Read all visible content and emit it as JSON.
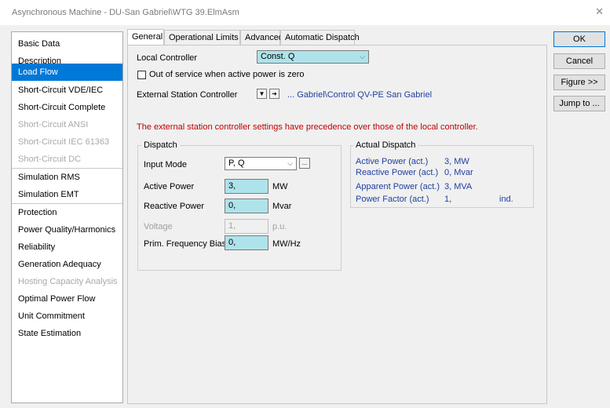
{
  "window": {
    "title": "Asynchronous Machine - DU-San Gabriel\\WTG 39.ElmAsm",
    "close_glyph": "✕"
  },
  "nav": {
    "items": [
      {
        "label": "Basic Data",
        "state": "normal"
      },
      {
        "label": "Description",
        "state": "normal"
      },
      {
        "label": "Load Flow",
        "state": "selected"
      },
      {
        "label": "Short-Circuit VDE/IEC",
        "state": "normal"
      },
      {
        "label": "Short-Circuit Complete",
        "state": "normal"
      },
      {
        "label": "Short-Circuit ANSI",
        "state": "disabled"
      },
      {
        "label": "Short-Circuit IEC 61363",
        "state": "disabled"
      },
      {
        "label": "Short-Circuit DC",
        "state": "disabled"
      },
      {
        "label": "Simulation RMS",
        "state": "normal"
      },
      {
        "label": "Simulation EMT",
        "state": "normal"
      },
      {
        "label": "Protection",
        "state": "normal"
      },
      {
        "label": "Power Quality/Harmonics",
        "state": "normal"
      },
      {
        "label": "Reliability",
        "state": "normal"
      },
      {
        "label": "Generation Adequacy",
        "state": "normal"
      },
      {
        "label": "Hosting Capacity Analysis",
        "state": "disabled"
      },
      {
        "label": "Optimal Power Flow",
        "state": "normal"
      },
      {
        "label": "Unit Commitment",
        "state": "normal"
      },
      {
        "label": "State Estimation",
        "state": "normal"
      }
    ]
  },
  "tabs": [
    {
      "label": "General",
      "active": true
    },
    {
      "label": "Operational Limits",
      "active": false
    },
    {
      "label": "Advanced",
      "active": false
    },
    {
      "label": "Automatic Dispatch",
      "active": false
    }
  ],
  "general": {
    "local_controller_label": "Local Controller",
    "local_controller_value": "Const. Q",
    "out_of_service_label": "Out of service when active power is zero",
    "out_of_service_checked": false,
    "external_controller_label": "External Station Controller",
    "external_controller_link": "... Gabriel\\Control QV-PE San Gabriel",
    "warning": "The external station controller settings have precedence over those of the local controller."
  },
  "dispatch": {
    "title": "Dispatch",
    "input_mode_label": "Input Mode",
    "input_mode_value": "P, Q",
    "more_button": "...",
    "active_power_label": "Active Power",
    "active_power_value": "3,",
    "active_power_unit": "MW",
    "reactive_power_label": "Reactive Power",
    "reactive_power_value": "0,",
    "reactive_power_unit": "Mvar",
    "voltage_label": "Voltage",
    "voltage_value": "1,",
    "voltage_unit": "p.u.",
    "freq_bias_label": "Prim. Frequency Bias",
    "freq_bias_value": "0,",
    "freq_bias_unit": "MW/Hz"
  },
  "actual_dispatch": {
    "title": "Actual Dispatch",
    "rows": [
      {
        "label": "Active Power (act.)",
        "value": "3, MW",
        "extra": ""
      },
      {
        "label": "Reactive Power (act.)",
        "value": "0, Mvar",
        "extra": ""
      },
      {
        "label": "Apparent Power (act.)",
        "value": "3, MVA",
        "extra": ""
      },
      {
        "label": "Power Factor (act.)",
        "value": "1,",
        "extra": "ind."
      }
    ]
  },
  "buttons": {
    "ok": "OK",
    "cancel": "Cancel",
    "figure": "Figure >>",
    "jump": "Jump to ..."
  },
  "colors": {
    "selected_nav": "#0078d7",
    "input_fill": "#aee3eb",
    "warning_text": "#c00000",
    "link_text": "#1f3fa0"
  }
}
